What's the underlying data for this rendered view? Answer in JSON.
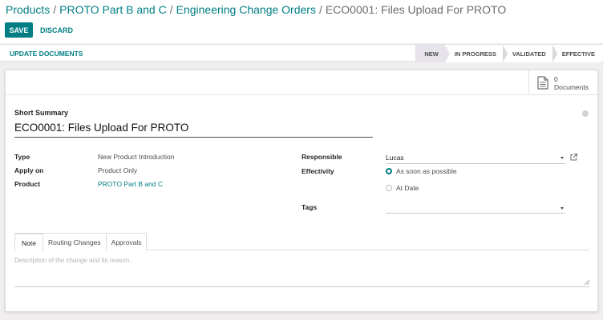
{
  "breadcrumb": {
    "items": [
      "Products",
      "PROTO Part B and C",
      "Engineering Change Orders"
    ],
    "current": "ECO0001: Files Upload For PROTO",
    "separator": "/"
  },
  "actions": {
    "save": "SAVE",
    "discard": "DISCARD"
  },
  "statusbar": {
    "update_label": "UPDATE DOCUMENTS",
    "stages": [
      "NEW",
      "IN PROGRESS",
      "VALIDATED",
      "EFFECTIVE"
    ],
    "active_stage": "NEW"
  },
  "smart_button": {
    "count": "0",
    "label": "Documents",
    "icon": "document-icon"
  },
  "form": {
    "summary_label": "Short Summary",
    "summary_value": "ECO0001: Files Upload For PROTO",
    "type_label": "Type",
    "type_value": "New Product Introduction",
    "apply_label": "Apply on",
    "apply_value": "Product Only",
    "product_label": "Product",
    "product_value": "PROTO Part B and C",
    "responsible_label": "Responsible",
    "responsible_value": "Lucas",
    "effectivity_label": "Effectivity",
    "effectivity_options": [
      "As soon as possible",
      "At Date"
    ],
    "effectivity_selected": "As soon as possible",
    "tags_label": "Tags",
    "tags_value": ""
  },
  "tabs": {
    "items": [
      "Note",
      "Routing Changes",
      "Approvals"
    ],
    "active": "Note"
  },
  "note": {
    "placeholder": "Description of the change and its reason."
  },
  "colors": {
    "accent": "#017e84",
    "active_stage_bg": "#e7e3ea"
  }
}
